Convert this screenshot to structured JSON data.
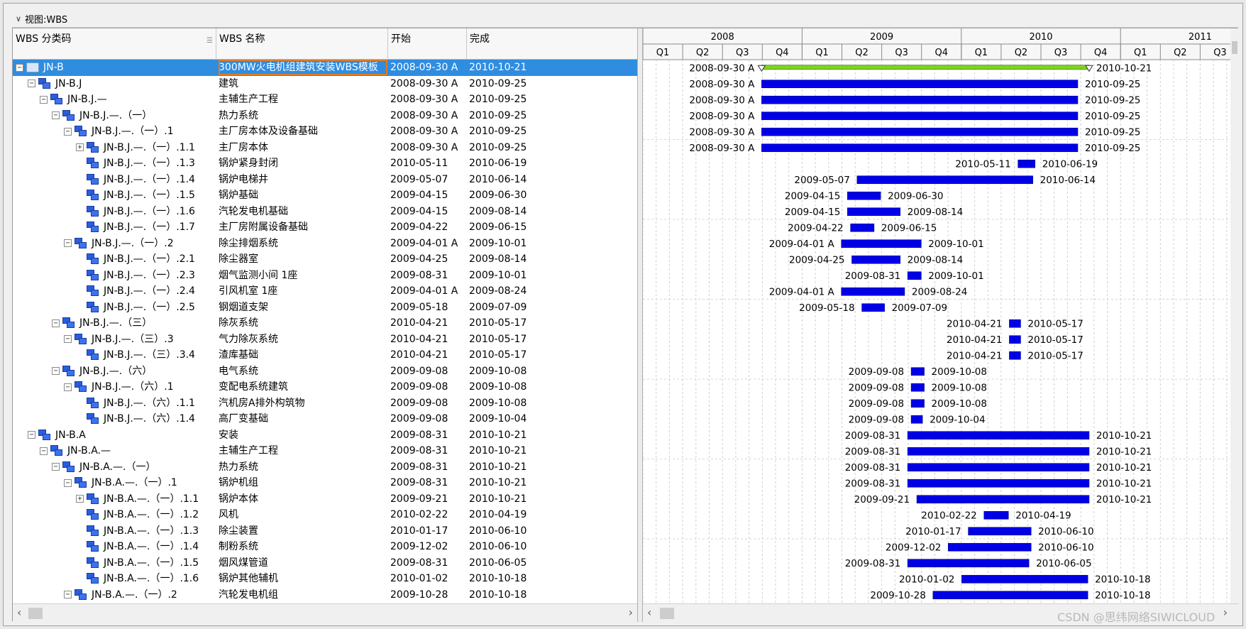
{
  "view_title": "视图:WBS",
  "columns": {
    "code": "WBS 分类码",
    "name": "WBS 名称",
    "start": "开始",
    "finish": "完成"
  },
  "timescale": {
    "years": [
      "2008",
      "2009",
      "2010",
      "2011"
    ],
    "quarters": [
      "Q1",
      "Q2",
      "Q3",
      "Q4",
      "Q1",
      "Q2",
      "Q3",
      "Q4",
      "Q1",
      "Q2",
      "Q3",
      "Q4",
      "Q1",
      "Q2",
      "Q3"
    ]
  },
  "colors": {
    "bar": "#0000e6",
    "summary_bar": "#7ed321",
    "selection": "#2f8de0"
  },
  "rows": [
    {
      "code": "JN-B",
      "name": "300MW火电机组建筑安装WBS模板",
      "start": "2008-09-30 A",
      "finish": "2010-10-21",
      "level": 0,
      "exp": "minus",
      "icon": "folder",
      "summary": true,
      "selected": true
    },
    {
      "code": "JN-B.J",
      "name": "建筑",
      "start": "2008-09-30 A",
      "finish": "2010-09-25",
      "level": 1,
      "exp": "minus",
      "icon": "wbs"
    },
    {
      "code": "JN-B.J.—",
      "name": "主辅生产工程",
      "start": "2008-09-30 A",
      "finish": "2010-09-25",
      "level": 2,
      "exp": "minus",
      "icon": "wbs"
    },
    {
      "code": "JN-B.J.—.（一）",
      "name": "热力系统",
      "start": "2008-09-30 A",
      "finish": "2010-09-25",
      "level": 3,
      "exp": "minus",
      "icon": "wbs"
    },
    {
      "code": "JN-B.J.—.（一）.1",
      "name": "主厂房本体及设备基础",
      "start": "2008-09-30 A",
      "finish": "2010-09-25",
      "level": 4,
      "exp": "minus",
      "icon": "wbs"
    },
    {
      "code": "JN-B.J.—.（一）.1.1",
      "name": "主厂房本体",
      "start": "2008-09-30 A",
      "finish": "2010-09-25",
      "level": 5,
      "exp": "plus",
      "icon": "wbs"
    },
    {
      "code": "JN-B.J.—.（一）.1.3",
      "name": "锅炉紧身封闭",
      "start": "2010-05-11",
      "finish": "2010-06-19",
      "level": 5,
      "exp": "none",
      "icon": "wbs"
    },
    {
      "code": "JN-B.J.—.（一）.1.4",
      "name": "锅炉电梯井",
      "start": "2009-05-07",
      "finish": "2010-06-14",
      "level": 5,
      "exp": "none",
      "icon": "wbs"
    },
    {
      "code": "JN-B.J.—.（一）.1.5",
      "name": "锅炉基础",
      "start": "2009-04-15",
      "finish": "2009-06-30",
      "level": 5,
      "exp": "none",
      "icon": "wbs"
    },
    {
      "code": "JN-B.J.—.（一）.1.6",
      "name": "汽轮发电机基础",
      "start": "2009-04-15",
      "finish": "2009-08-14",
      "level": 5,
      "exp": "none",
      "icon": "wbs"
    },
    {
      "code": "JN-B.J.—.（一）.1.7",
      "name": "主厂房附属设备基础",
      "start": "2009-04-22",
      "finish": "2009-06-15",
      "level": 5,
      "exp": "none",
      "icon": "wbs"
    },
    {
      "code": "JN-B.J.—.（一）.2",
      "name": "除尘排烟系统",
      "start": "2009-04-01 A",
      "finish": "2009-10-01",
      "level": 4,
      "exp": "minus",
      "icon": "wbs"
    },
    {
      "code": "JN-B.J.—.（一）.2.1",
      "name": "除尘器室",
      "start": "2009-04-25",
      "finish": "2009-08-14",
      "level": 5,
      "exp": "none",
      "icon": "wbs"
    },
    {
      "code": "JN-B.J.—.（一）.2.3",
      "name": "烟气监测小间 1座",
      "start": "2009-08-31",
      "finish": "2009-10-01",
      "level": 5,
      "exp": "none",
      "icon": "wbs"
    },
    {
      "code": "JN-B.J.—.（一）.2.4",
      "name": "引风机室 1座",
      "start": "2009-04-01 A",
      "finish": "2009-08-24",
      "level": 5,
      "exp": "none",
      "icon": "wbs"
    },
    {
      "code": "JN-B.J.—.（一）.2.5",
      "name": "钢烟道支架",
      "start": "2009-05-18",
      "finish": "2009-07-09",
      "level": 5,
      "exp": "none",
      "icon": "wbs"
    },
    {
      "code": "JN-B.J.—.（三）",
      "name": "除灰系统",
      "start": "2010-04-21",
      "finish": "2010-05-17",
      "level": 3,
      "exp": "minus",
      "icon": "wbs"
    },
    {
      "code": "JN-B.J.—.（三）.3",
      "name": "气力除灰系统",
      "start": "2010-04-21",
      "finish": "2010-05-17",
      "level": 4,
      "exp": "minus",
      "icon": "wbs"
    },
    {
      "code": "JN-B.J.—.（三）.3.4",
      "name": "渣库基础",
      "start": "2010-04-21",
      "finish": "2010-05-17",
      "level": 5,
      "exp": "none",
      "icon": "wbs"
    },
    {
      "code": "JN-B.J.—.（六）",
      "name": "电气系统",
      "start": "2009-09-08",
      "finish": "2009-10-08",
      "level": 3,
      "exp": "minus",
      "icon": "wbs"
    },
    {
      "code": "JN-B.J.—.（六）.1",
      "name": "变配电系统建筑",
      "start": "2009-09-08",
      "finish": "2009-10-08",
      "level": 4,
      "exp": "minus",
      "icon": "wbs"
    },
    {
      "code": "JN-B.J.—.（六）.1.1",
      "name": "汽机房A排外构筑物",
      "start": "2009-09-08",
      "finish": "2009-10-08",
      "level": 5,
      "exp": "none",
      "icon": "wbs"
    },
    {
      "code": "JN-B.J.—.（六）.1.4",
      "name": "高厂变基础",
      "start": "2009-09-08",
      "finish": "2009-10-04",
      "level": 5,
      "exp": "none",
      "icon": "wbs"
    },
    {
      "code": "JN-B.A",
      "name": "安装",
      "start": "2009-08-31",
      "finish": "2010-10-21",
      "level": 1,
      "exp": "minus",
      "icon": "wbs"
    },
    {
      "code": "JN-B.A.—",
      "name": "主辅生产工程",
      "start": "2009-08-31",
      "finish": "2010-10-21",
      "level": 2,
      "exp": "minus",
      "icon": "wbs"
    },
    {
      "code": "JN-B.A.—.（一）",
      "name": "热力系统",
      "start": "2009-08-31",
      "finish": "2010-10-21",
      "level": 3,
      "exp": "minus",
      "icon": "wbs"
    },
    {
      "code": "JN-B.A.—.（一）.1",
      "name": "锅炉机组",
      "start": "2009-08-31",
      "finish": "2010-10-21",
      "level": 4,
      "exp": "minus",
      "icon": "wbs"
    },
    {
      "code": "JN-B.A.—.（一）.1.1",
      "name": "锅炉本体",
      "start": "2009-09-21",
      "finish": "2010-10-21",
      "level": 5,
      "exp": "plus",
      "icon": "wbs"
    },
    {
      "code": "JN-B.A.—.（一）.1.2",
      "name": "风机",
      "start": "2010-02-22",
      "finish": "2010-04-19",
      "level": 5,
      "exp": "none",
      "icon": "wbs"
    },
    {
      "code": "JN-B.A.—.（一）.1.3",
      "name": "除尘装置",
      "start": "2010-01-17",
      "finish": "2010-06-10",
      "level": 5,
      "exp": "none",
      "icon": "wbs"
    },
    {
      "code": "JN-B.A.—.（一）.1.4",
      "name": "制粉系统",
      "start": "2009-12-02",
      "finish": "2010-06-10",
      "level": 5,
      "exp": "none",
      "icon": "wbs"
    },
    {
      "code": "JN-B.A.—.（一）.1.5",
      "name": "烟风煤管道",
      "start": "2009-08-31",
      "finish": "2010-06-05",
      "level": 5,
      "exp": "none",
      "icon": "wbs"
    },
    {
      "code": "JN-B.A.—.（一）.1.6",
      "name": "锅炉其他辅机",
      "start": "2010-01-02",
      "finish": "2010-10-18",
      "level": 5,
      "exp": "none",
      "icon": "wbs"
    },
    {
      "code": "JN-B.A.—.（一）.2",
      "name": "汽轮发电机组",
      "start": "2009-10-28",
      "finish": "2010-10-18",
      "level": 4,
      "exp": "minus",
      "icon": "wbs"
    }
  ],
  "watermark": "CSDN @思纬网络SIWICLOUD"
}
